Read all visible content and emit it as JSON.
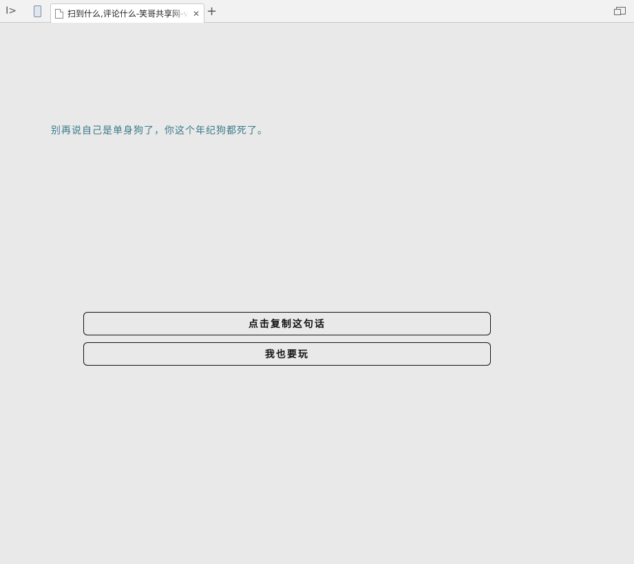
{
  "browser": {
    "tab_title": "扫到什么,评论什么-笑哥共享网-v",
    "tab_close": "✕",
    "new_tab": "+",
    "sidebar_toggle": "I>"
  },
  "main": {
    "quote_text": "别再说自己是单身狗了，你这个年纪狗都死了。",
    "copy_button_label": "点击复制这句话",
    "play_button_label": "我也要玩"
  },
  "colors": {
    "background": "#e9e9e9",
    "quote_text": "#3a7a8a",
    "button_border": "#111111"
  }
}
